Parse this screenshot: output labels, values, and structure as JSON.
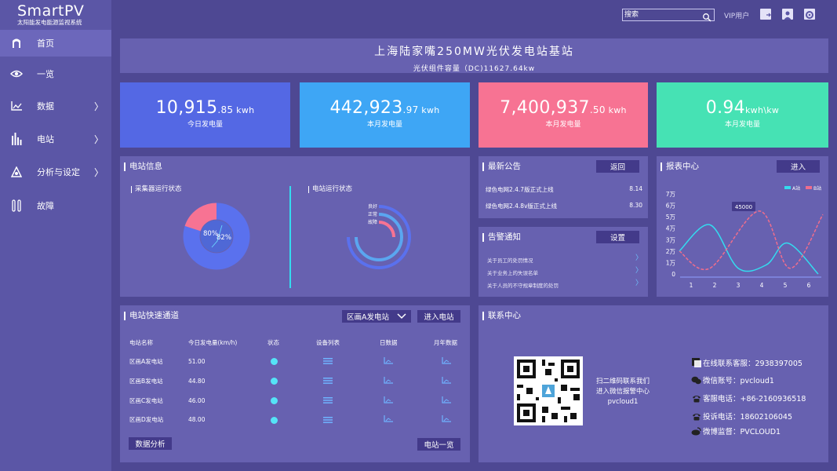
{
  "brand": {
    "name": "SmartPV",
    "subtitle": "太阳能发电能源监视系统"
  },
  "nav": [
    {
      "label": "首页",
      "icon": "home-arch-icon",
      "active": true
    },
    {
      "label": "一览",
      "icon": "eye-icon"
    },
    {
      "label": "数据",
      "icon": "data-chart-icon",
      "chevron": "〉"
    },
    {
      "label": "电站",
      "icon": "station-bars-icon",
      "chevron": "〉"
    },
    {
      "label": "分析与设定",
      "icon": "analysis-icon",
      "chevron": "〉"
    },
    {
      "label": "故障",
      "icon": "fault-tools-icon"
    }
  ],
  "topbar": {
    "search_placeholder": "搜索",
    "vip": "VIP用户"
  },
  "banner": {
    "title": "上海陆家嘴250MW光伏发电站基站",
    "capacity": "光伏组件容量（DC)11627.64kw"
  },
  "stats": [
    {
      "int": "10,915",
      "dec": ".85",
      "unit": " kwh",
      "label": "今日发电量",
      "color": "#5468e4"
    },
    {
      "int": "442,923",
      "dec": ".97",
      "unit": " kwh",
      "label": "本月发电量",
      "color": "#3ea6f5"
    },
    {
      "int": "7,400,937",
      "dec": ".50",
      "unit": " kwh",
      "label": "本月发电量",
      "color": "#f77393"
    },
    {
      "int": "0.94",
      "dec": "",
      "unit": "kwh\\kw",
      "label": "本月发电量",
      "color": "#46e2b4"
    }
  ],
  "station_info": {
    "title": "电站信息",
    "collector": {
      "title": "采集器运行状态",
      "outer_pct": "80%",
      "inner_pct": "82%",
      "outer": 0.8
    },
    "station": {
      "title": "电站运行状态",
      "legend": [
        "良好",
        "正常",
        "故障"
      ]
    }
  },
  "announcements": {
    "title": "最新公告",
    "button": "返回",
    "items": [
      {
        "text": "绿色电网2.4.7版正式上线",
        "date": "8.14"
      },
      {
        "text": "绿色电网2.4.8v版正式上线",
        "date": "8.30"
      }
    ]
  },
  "alarms": {
    "title": "告警通知",
    "button": "设置",
    "items": [
      "关于员工的处罚情况",
      "关于业务上的失误名单",
      "关于人员的不守规章制度的处罚"
    ],
    "chevron": "〉"
  },
  "report": {
    "title": "报表中心",
    "button": "进入",
    "tooltip": "45000",
    "legend": [
      "A站",
      "B站"
    ],
    "colors": {
      "a": "#34dbef",
      "b": "#ef6d8d"
    }
  },
  "chart_data": {
    "type": "line",
    "x": [
      1,
      2,
      3,
      4,
      5,
      6
    ],
    "y_ticks": [
      "0",
      "1万",
      "2万",
      "3万",
      "4万",
      "5万",
      "6万",
      "7万"
    ],
    "ylim": [
      0,
      70000
    ],
    "series": [
      {
        "name": "A站",
        "values": [
          [
            0.5,
            20000
          ],
          [
            1.8,
            43000
          ],
          [
            3,
            5000
          ],
          [
            4.2,
            8000
          ],
          [
            5.1,
            27000
          ],
          [
            6.4,
            0
          ]
        ]
      },
      {
        "name": "B站",
        "values": [
          [
            0.5,
            20000
          ],
          [
            1.8,
            5000
          ],
          [
            3.9,
            55000
          ],
          [
            5.2,
            5000
          ],
          [
            6.6,
            52000
          ]
        ]
      }
    ]
  },
  "quick": {
    "title": "电站快速通道",
    "select": "区画A发电站",
    "enter_button": "进入电站",
    "headers": [
      "电站名称",
      "今日发电量(km/h)",
      "状态",
      "设备列表",
      "日数据",
      "月年数据"
    ],
    "rows": [
      {
        "name": "区画A发电站",
        "value": "51.00"
      },
      {
        "name": "区画B发电站",
        "value": "44.80"
      },
      {
        "name": "区画C发电站",
        "value": "46.00"
      },
      {
        "name": "区画D发电站",
        "value": "48.00"
      }
    ],
    "analysis_button": "数据分析",
    "list_button": "电站一览"
  },
  "contact": {
    "title": "联系中心",
    "qr_text": [
      "扫二维码联系我们",
      "进入微信报警中心",
      "pvcloud1"
    ],
    "items": [
      {
        "icon": "chat-square-icon",
        "text": "在线联系客服：2938397005"
      },
      {
        "icon": "wechat-icon",
        "text": "微信账号：pvcloud1"
      },
      {
        "icon": "phone-icon",
        "text": "客服电话：+86-2160936518"
      },
      {
        "icon": "phone-icon",
        "text": "投诉电话：18602106045"
      },
      {
        "icon": "weibo-icon",
        "text": "微博监督：PVCLOUD1"
      }
    ]
  }
}
